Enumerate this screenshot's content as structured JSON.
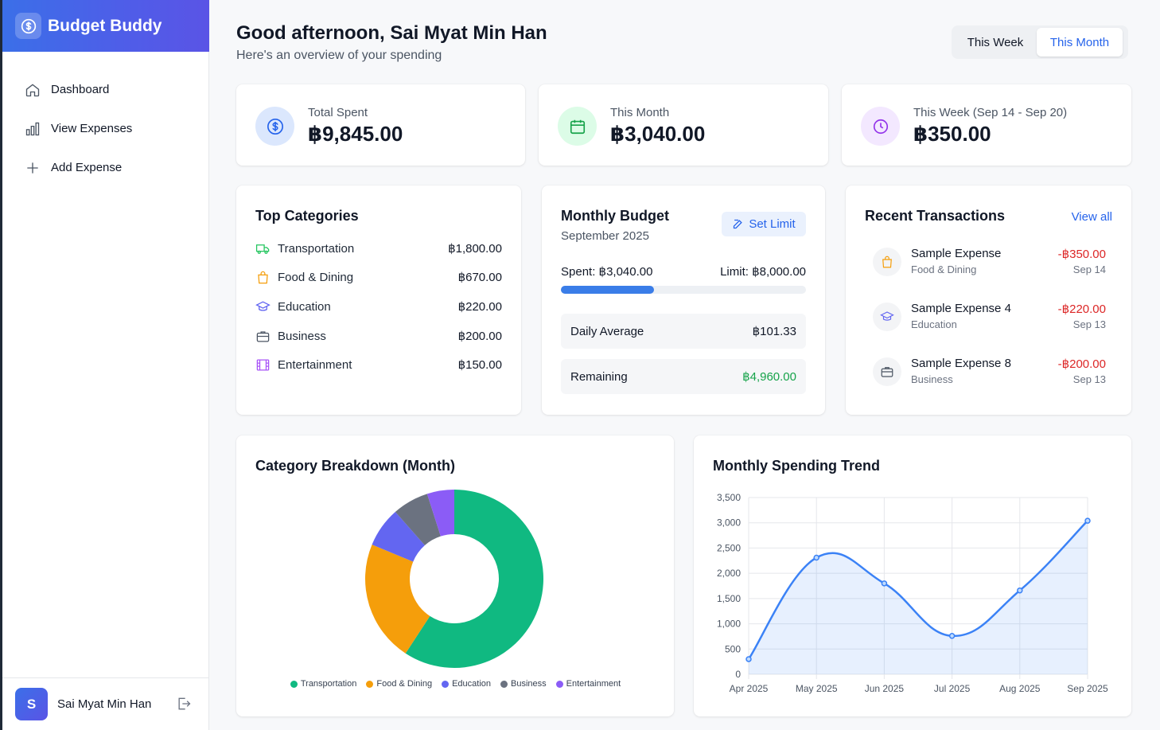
{
  "app": {
    "name": "Budget Buddy"
  },
  "sidebar": {
    "items": [
      {
        "label": "Dashboard",
        "icon": "home-icon"
      },
      {
        "label": "View Expenses",
        "icon": "bar-chart-icon"
      },
      {
        "label": "Add Expense",
        "icon": "plus-icon"
      }
    ],
    "user": {
      "initial": "S",
      "name": "Sai Myat Min Han"
    }
  },
  "header": {
    "greeting": "Good afternoon, Sai Myat Min Han",
    "subtitle": "Here's an overview of your spending",
    "period_toggle": {
      "week": "This Week",
      "month": "This Month",
      "selected": "This Month"
    }
  },
  "stats": [
    {
      "label": "Total Spent",
      "value": "฿9,845.00",
      "icon": "dollar-circle-icon",
      "color": "#2563eb"
    },
    {
      "label": "This Month",
      "value": "฿3,040.00",
      "icon": "calendar-icon",
      "color": "#16a34a"
    },
    {
      "label": "This Week (Sep 14 - Sep 20)",
      "value": "฿350.00",
      "icon": "clock-icon",
      "color": "#9333ea"
    }
  ],
  "top_categories": {
    "title": "Top Categories",
    "items": [
      {
        "label": "Transportation",
        "amount": "฿1,800.00",
        "icon": "truck-icon",
        "color": "#22c55e"
      },
      {
        "label": "Food & Dining",
        "amount": "฿670.00",
        "icon": "shopping-bag-icon",
        "color": "#f59e0b"
      },
      {
        "label": "Education",
        "amount": "฿220.00",
        "icon": "graduation-cap-icon",
        "color": "#6366f1"
      },
      {
        "label": "Business",
        "amount": "฿200.00",
        "icon": "briefcase-icon",
        "color": "#4b5563"
      },
      {
        "label": "Entertainment",
        "amount": "฿150.00",
        "icon": "film-icon",
        "color": "#a855f7"
      }
    ]
  },
  "budget": {
    "title": "Monthly Budget",
    "month": "September 2025",
    "set_limit_label": "Set Limit",
    "spent_text": "Spent: ฿3,040.00",
    "limit_text": "Limit: ฿8,000.00",
    "progress": 0.38,
    "daily_average_label": "Daily Average",
    "daily_average_value": "฿101.33",
    "remaining_label": "Remaining",
    "remaining_value": "฿4,960.00"
  },
  "recent": {
    "title": "Recent Transactions",
    "view_all_label": "View all",
    "items": [
      {
        "name": "Sample Expense",
        "category": "Food & Dining",
        "amount": "-฿350.00",
        "date": "Sep 14",
        "icon": "shopping-bag-icon"
      },
      {
        "name": "Sample Expense 4",
        "category": "Education",
        "amount": "-฿220.00",
        "date": "Sep 13",
        "icon": "graduation-cap-icon"
      },
      {
        "name": "Sample Expense 8",
        "category": "Business",
        "amount": "-฿200.00",
        "date": "Sep 13",
        "icon": "briefcase-icon"
      }
    ]
  },
  "chart_data": [
    {
      "type": "pie",
      "title": "Category Breakdown (Month)",
      "donut": true,
      "categories": [
        "Transportation",
        "Food & Dining",
        "Education",
        "Business",
        "Entertainment"
      ],
      "values": [
        1800,
        670,
        220,
        200,
        150
      ],
      "colors": [
        "#10b981",
        "#f59e0b",
        "#6366f1",
        "#6b7280",
        "#8b5cf6"
      ],
      "legend": "bottom"
    },
    {
      "type": "area",
      "title": "Monthly Spending Trend",
      "x": [
        "Apr 2025",
        "May 2025",
        "Jun 2025",
        "Jul 2025",
        "Aug 2025",
        "Sep 2025"
      ],
      "values": [
        300,
        2310,
        1800,
        760,
        1660,
        3040
      ],
      "ylim": [
        0,
        3500
      ],
      "yticks": [
        "0",
        "500",
        "1,000",
        "1,500",
        "2,000",
        "2,500",
        "3,000",
        "3,500"
      ],
      "grid": true,
      "color": "#3b82f6"
    }
  ]
}
